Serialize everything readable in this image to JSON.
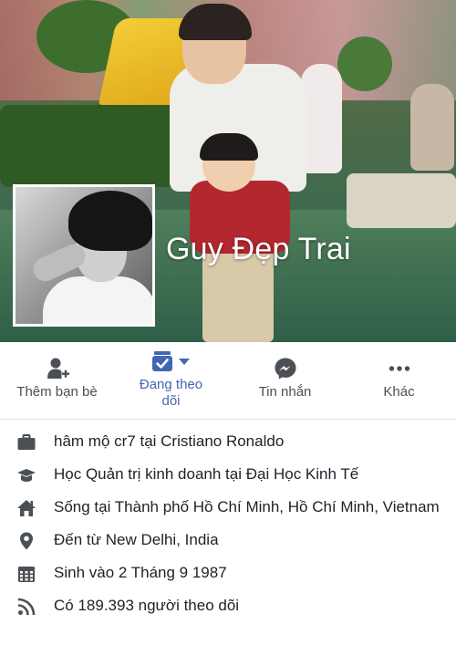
{
  "profile": {
    "name": "Guy Đẹp Trai"
  },
  "actions": [
    {
      "label": "Thêm bạn bè",
      "icon": "add-friend-icon"
    },
    {
      "label": "Đang theo dõi",
      "icon": "following-icon"
    },
    {
      "label": "Tin nhắn",
      "icon": "messenger-icon"
    },
    {
      "label": "Khác",
      "icon": "more-icon"
    }
  ],
  "info": [
    {
      "icon": "briefcase-icon",
      "text": "hâm mộ cr7 tại Cristiano Ronaldo"
    },
    {
      "icon": "graduation-cap-icon",
      "text": "Học Quản trị kinh doanh tại Đại Học Kinh Tế"
    },
    {
      "icon": "home-icon",
      "text": "Sống tại Thành phố Hồ Chí Minh, Hồ Chí Minh, Vietnam"
    },
    {
      "icon": "location-pin-icon",
      "text": "Đến từ New Delhi, India"
    },
    {
      "icon": "calendar-icon",
      "text": "Sinh vào 2 Tháng 9 1987"
    },
    {
      "icon": "rss-feed-icon",
      "text": "Có 189.393 người theo dõi"
    }
  ],
  "colors": {
    "accent": "#4267b2",
    "icon_gray": "#4b4f56",
    "text": "#1d2129"
  }
}
